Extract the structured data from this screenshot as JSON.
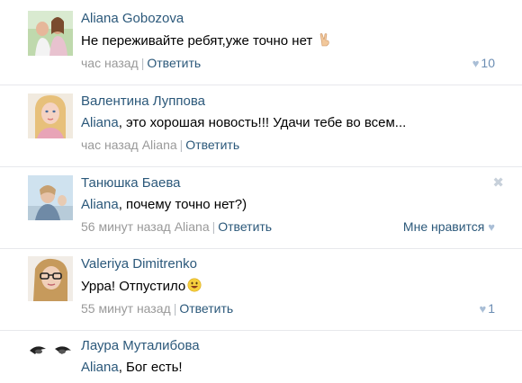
{
  "comments": [
    {
      "author": "Aliana Gobozova",
      "text": "Не переживайте ребят,уже точно нет",
      "emoji": "victory-hand-emoji",
      "time": "час назад",
      "reply_label": "Ответить",
      "likes": "10"
    },
    {
      "author": "Валентина Луппова",
      "mention": "Aliana",
      "text": ", это хорошая новость!!! Удачи тебе во всем...",
      "time": "час назад",
      "reply_to": "Aliana",
      "reply_label": "Ответить"
    },
    {
      "author": "Танюшка Баева",
      "mention": "Aliana",
      "text": ", почему точно нет?)",
      "time": "56 минут назад",
      "reply_to": "Aliana",
      "reply_label": "Ответить",
      "like_label": "Мне нравится"
    },
    {
      "author": "Valeriya Dimitrenko",
      "text": "Урра! Отпустило",
      "emoji": "smiley-emoji",
      "time": "55 минут назад",
      "reply_label": "Ответить",
      "likes": "1"
    },
    {
      "author": "Лаура Муталибова",
      "mention": "Aliana",
      "text": ", Бог есть!"
    }
  ],
  "colors": {
    "link": "#2b587a",
    "meta": "#999999",
    "divider": "#e7e8ec",
    "like_count": "#6b8db3"
  }
}
